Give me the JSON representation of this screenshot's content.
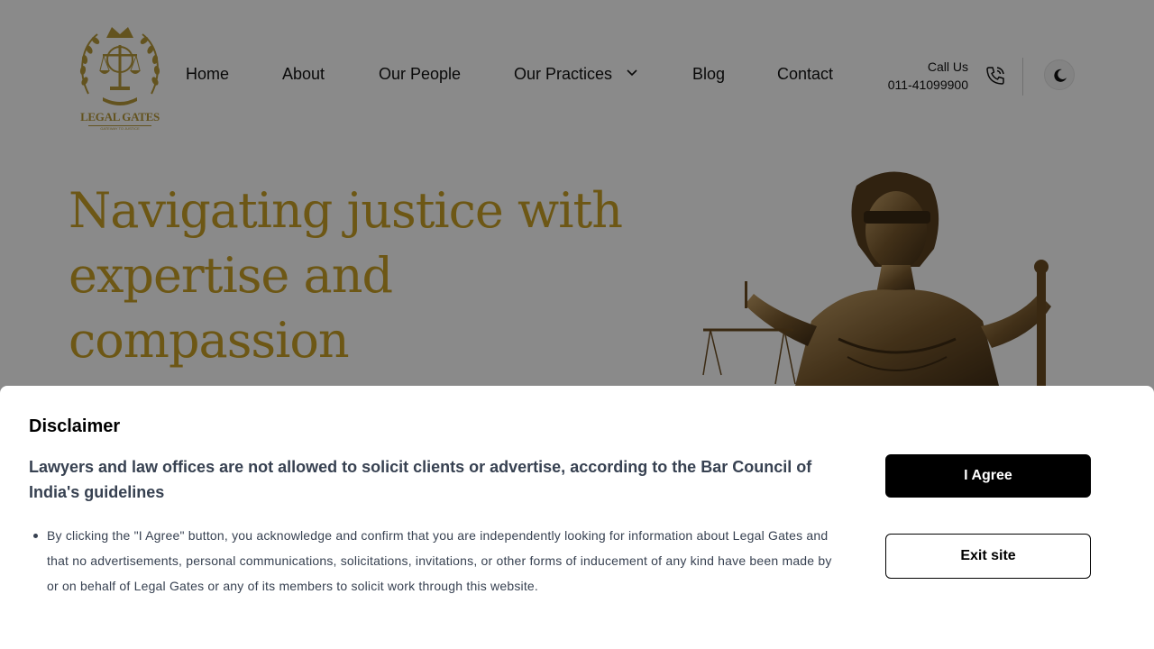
{
  "header": {
    "logo": {
      "name": "LEGAL GATES",
      "tagline": "GATEWAY TO JUSTICE",
      "brand_color": "#b89a3a"
    },
    "nav": [
      {
        "label": "Home"
      },
      {
        "label": "About"
      },
      {
        "label": "Our People"
      },
      {
        "label": "Our Practices",
        "has_dropdown": true
      },
      {
        "label": "Blog"
      },
      {
        "label": "Contact"
      }
    ],
    "call": {
      "label": "Call Us",
      "number": "011-41099900",
      "icon": "phone-icon"
    },
    "theme_toggle": {
      "icon": "moon-icon"
    }
  },
  "hero": {
    "title": "Navigating justice with expertise and compassion",
    "title_color": "#c9a227",
    "image": "lady-justice-statue"
  },
  "disclaimer": {
    "title": "Disclaimer",
    "subtitle": "Lawyers and law offices are not allowed to solicit clients or advertise, according to the Bar Council of India's guidelines",
    "items": [
      "By clicking the \"I Agree\" button, you acknowledge and confirm that you are independently looking for information about Legal Gates and that no advertisements, personal communications, solicitations, invitations, or other forms of inducement of any kind have been made by or on behalf of Legal Gates or any of its members to solicit work through this website."
    ],
    "agree_label": "I Agree",
    "exit_label": "Exit site"
  }
}
